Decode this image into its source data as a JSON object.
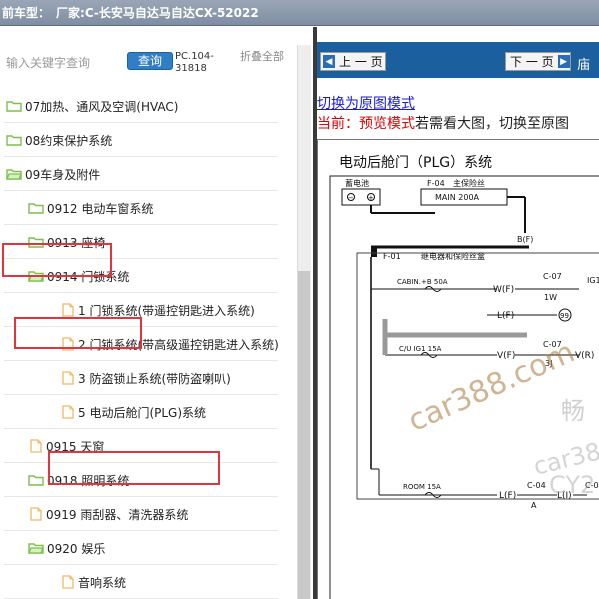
{
  "titlebar": {
    "label": "前车型：",
    "value": "厂家:C-长安马自达马自达CX-52022"
  },
  "search": {
    "placeholder": "输入关键字查询",
    "button": "查询",
    "code": "PC.104-31818",
    "collapse_all": "折叠全部"
  },
  "tree": [
    {
      "label": "07加热、通风及空调(HVAC)",
      "type": "folder",
      "level": 0,
      "open": false
    },
    {
      "label": "08约束保护系统",
      "type": "folder",
      "level": 0,
      "open": false
    },
    {
      "label": "09车身及附件",
      "type": "folder",
      "level": 0,
      "open": true,
      "highlighted": true
    },
    {
      "label": "0912 电动车窗系统",
      "type": "folder",
      "level": 1,
      "open": false
    },
    {
      "label": "0913 座椅",
      "type": "folder",
      "level": 1,
      "open": false
    },
    {
      "label": "0914 门锁系统",
      "type": "folder",
      "level": 1,
      "open": true,
      "highlighted": true
    },
    {
      "label": "1 门锁系统(带遥控钥匙进入系统)",
      "type": "doc",
      "level": 2
    },
    {
      "label": "2 门锁系统(带高级遥控钥匙进入系统)",
      "type": "doc",
      "level": 2
    },
    {
      "label": "3 防盗锁止系统(带防盗喇叭)",
      "type": "doc",
      "level": 2
    },
    {
      "label": "5 电动后舱门(PLG)系统",
      "type": "doc",
      "level": 2,
      "highlighted": true
    },
    {
      "label": "0915 天窗",
      "type": "doc",
      "level": 1
    },
    {
      "label": "0918 照明系统",
      "type": "folder",
      "level": 1,
      "open": false
    },
    {
      "label": "0919 雨刮器、清洗器系统",
      "type": "doc",
      "level": 1
    },
    {
      "label": "0920 娱乐",
      "type": "folder",
      "level": 1,
      "open": false
    },
    {
      "label": "音响系统",
      "type": "doc",
      "level": 2
    }
  ],
  "viewer": {
    "prev": "上 一 页",
    "next": "下 一 页",
    "more": "庙",
    "switch_link": "切换为原图模式",
    "status_prefix": "当前：",
    "status_mode": "预览模式",
    "status_suffix": "若需看大图，切换至原图",
    "diagram": {
      "title": "电动后舱门（PLG）系统",
      "battery": "蓄电池",
      "f04": "F-04",
      "main_fuse_label": "主保险丝",
      "main_fuse": "MAIN 200A",
      "bf": "B(F)",
      "f01": "F-01",
      "relay_box": "继电器和保险丝盒",
      "cabin_fuse": "CABIN.+B 50A",
      "w_f": "W(F)",
      "c07": "C-07",
      "w1": "1W",
      "ig1": "IG1",
      "l_f": "L(F)",
      "ring99": "99",
      "cu_fuse": "C/U IG1 15A",
      "v_f": "V(F)",
      "c07b": "C-07",
      "j3": "3J",
      "v_r": "V(R)",
      "room_fuse": "ROOM 15A",
      "l_f2": "L(F)",
      "c04": "C-04",
      "a": "A",
      "l_i": "L(I)",
      "c0x": "C-0"
    },
    "watermarks": [
      "car388.com",
      "畅",
      "car38",
      "CY2"
    ]
  },
  "colors": {
    "navbar": "#1b5f9e",
    "highlight": "#e0353c",
    "folder": "#7cc04b",
    "doc": "#f0b868",
    "link": "#1a1ad6",
    "red_text": "#e00000"
  }
}
